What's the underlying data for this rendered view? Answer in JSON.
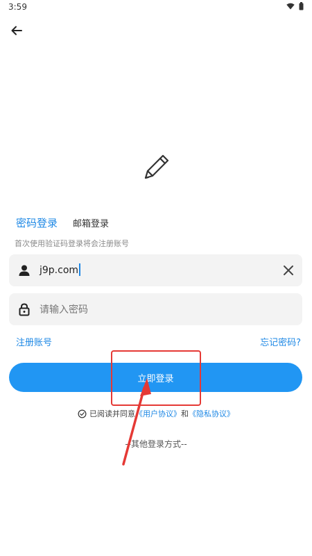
{
  "status_bar": {
    "time": "3:59",
    "icons": [
      "wifi-icon",
      "battery-icon"
    ]
  },
  "header": {
    "back_icon": "arrow-left-icon"
  },
  "logo": {
    "icon": "pencil-icon"
  },
  "tabs": [
    {
      "label": "密码登录",
      "active": true
    },
    {
      "label": "邮箱登录",
      "active": false
    }
  ],
  "hint": "首次使用验证码登录将会注册账号",
  "account_field": {
    "icon": "user-icon",
    "value": "j9p.com",
    "clear_icon": "close-icon"
  },
  "password_field": {
    "icon": "lock-icon",
    "placeholder": "请输入密码",
    "value": ""
  },
  "links": {
    "register": "注册账号",
    "forgot": "忘记密码?"
  },
  "login_button": {
    "label": "立即登录"
  },
  "agreement": {
    "checkbox_icon": "check-circle-icon",
    "prefix": "已阅读并同意",
    "user_agreement": "《用户协议》",
    "conjunction": "和",
    "privacy_policy": "《隐私协议》"
  },
  "other_login": "--其他登录方式--",
  "colors": {
    "accent": "#2196f3",
    "link": "#1e88e5",
    "annotation": "#e53935",
    "field_bg": "#f3f3f3"
  }
}
